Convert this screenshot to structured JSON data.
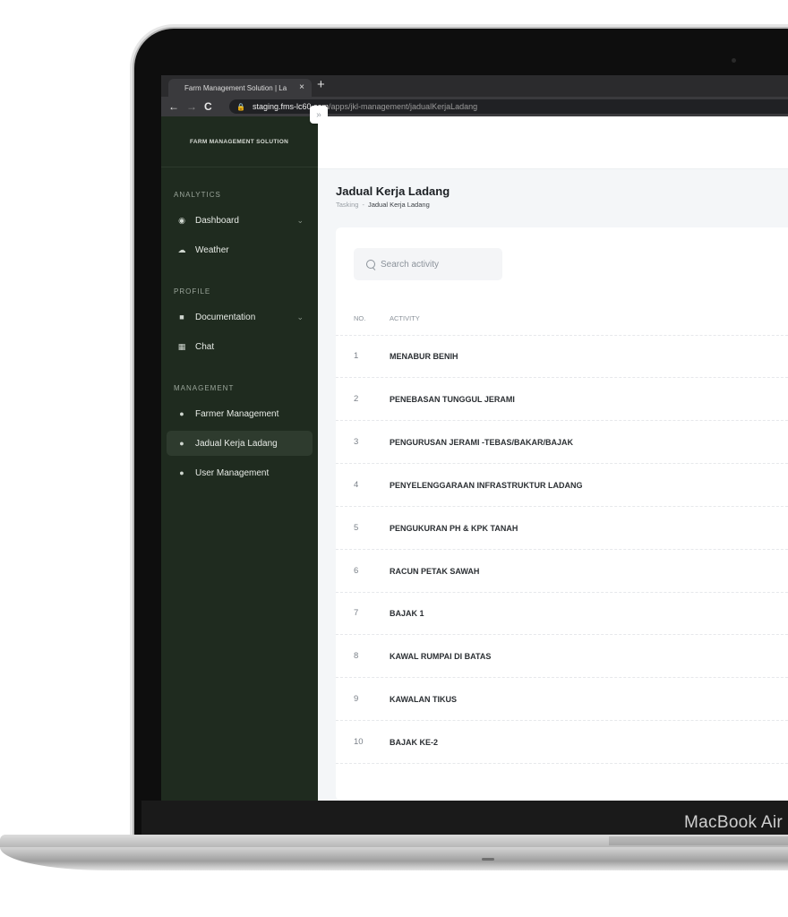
{
  "device": {
    "brand": "MacBook Air"
  },
  "browser": {
    "tab_title": "Farm Management Solution | La",
    "tab_close": "×",
    "new_tab": "+",
    "back": "←",
    "forward": "→",
    "reload": "C",
    "url_host": "staging.fms-lc60.com",
    "url_path": "/apps/jkl-management/jadualKerjaLadang"
  },
  "sidebar": {
    "app_name": "FARM MANAGEMENT SOLUTION",
    "collapse_icon": "»",
    "sections": [
      {
        "title": "ANALYTICS",
        "items": [
          {
            "label": "Dashboard",
            "icon": "dashboard-icon",
            "chevron": true
          },
          {
            "label": "Weather",
            "icon": "weather-icon",
            "chevron": false
          }
        ]
      },
      {
        "title": "PROFILE",
        "items": [
          {
            "label": "Documentation",
            "icon": "folder-icon",
            "chevron": true
          },
          {
            "label": "Chat",
            "icon": "chat-icon",
            "chevron": false
          }
        ]
      },
      {
        "title": "MANAGEMENT",
        "items": [
          {
            "label": "Farmer Management",
            "icon": "farmer-icon",
            "chevron": false
          },
          {
            "label": "Jadual Kerja Ladang",
            "icon": "schedule-icon",
            "chevron": false,
            "active": true
          },
          {
            "label": "User Management",
            "icon": "user-icon",
            "chevron": false
          }
        ]
      }
    ]
  },
  "page": {
    "title": "Jadual Kerja Ladang",
    "breadcrumb": [
      "Tasking",
      "Jadual Kerja Ladang"
    ],
    "breadcrumb_sep": "-"
  },
  "table": {
    "search_placeholder": "Search activity",
    "headers": {
      "no": "NO.",
      "activity": "ACTIVITY"
    },
    "rows": [
      {
        "no": "1",
        "activity": "MENABUR BENIH"
      },
      {
        "no": "2",
        "activity": "PENEBASAN TUNGGUL JERAMI"
      },
      {
        "no": "3",
        "activity": "PENGURUSAN JERAMI -TEBAS/BAKAR/BAJAK"
      },
      {
        "no": "4",
        "activity": "PENYELENGGARAAN INFRASTRUKTUR LADANG"
      },
      {
        "no": "5",
        "activity": "PENGUKURAN PH & KPK TANAH"
      },
      {
        "no": "6",
        "activity": "RACUN PETAK SAWAH"
      },
      {
        "no": "7",
        "activity": "BAJAK 1"
      },
      {
        "no": "8",
        "activity": "KAWAL RUMPAI DI BATAS"
      },
      {
        "no": "9",
        "activity": "KAWALAN TIKUS"
      },
      {
        "no": "10",
        "activity": "BAJAK KE-2"
      }
    ]
  },
  "colors": {
    "sidebar_bg": "#1f2b1f",
    "active_item_bg": "#2e3b2e",
    "content_bg": "#f4f6f8"
  }
}
